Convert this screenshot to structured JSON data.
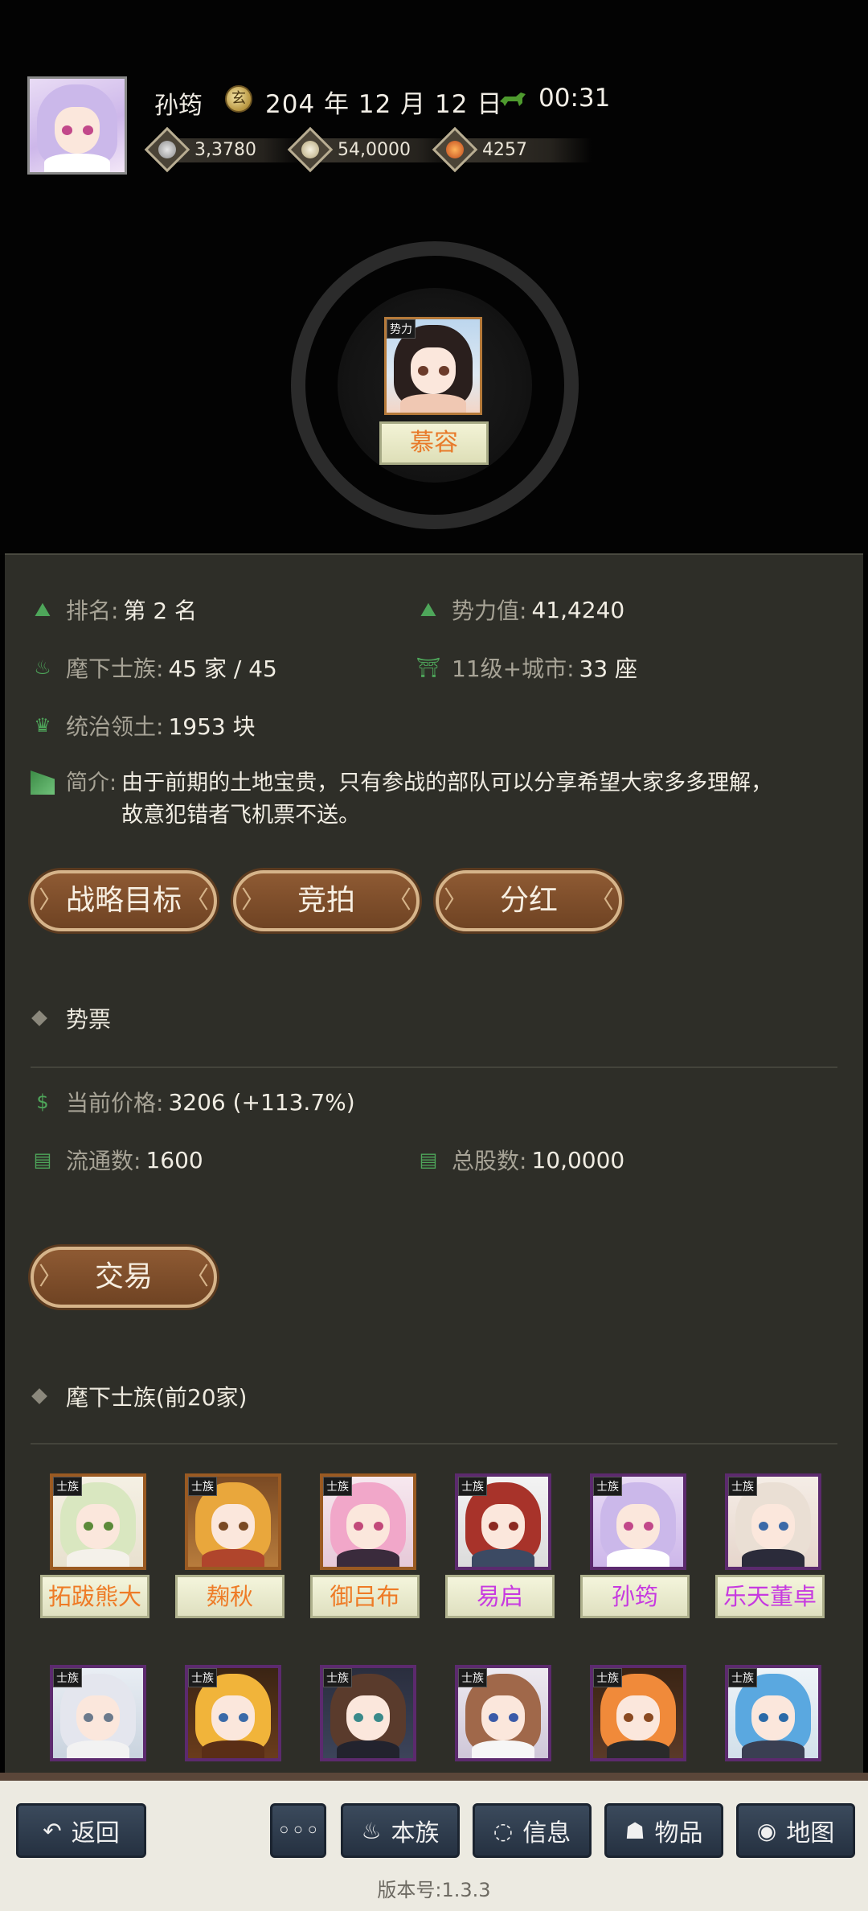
{
  "header": {
    "player_name": "孙筠",
    "date": "204 年 12 月 12 日",
    "time": "00:31",
    "resources": [
      {
        "icon": "silver-icon",
        "value": "3,3780"
      },
      {
        "icon": "rice-icon",
        "value": "54,0000"
      },
      {
        "icon": "medal-icon",
        "value": "4257"
      }
    ]
  },
  "faction": {
    "tag": "势力",
    "name": "慕容"
  },
  "stats": {
    "rank_label": "排名:",
    "rank_value": "第 2 名",
    "power_label": "势力值:",
    "power_value": "41,4240",
    "clans_label": "麾下士族:",
    "clans_value": "45 家 / 45",
    "cities_label": "11级+城市:",
    "cities_value": "33 座",
    "territory_label": "统治领土:",
    "territory_value": "1953 块",
    "intro_label": "简介:",
    "intro_value": "由于前期的土地宝贵，只有参战的部队可以分享希望大家多多理解，故意犯错者飞机票不送。"
  },
  "actions": {
    "strategy": "战略目标",
    "auction": "竞拍",
    "dividend": "分红"
  },
  "stock": {
    "title": "势票",
    "price_label": "当前价格:",
    "price_value": "3206 (+113.7%)",
    "circulation_label": "流通数:",
    "circulation_value": "1600",
    "total_label": "总股数:",
    "total_value": "10,0000",
    "trade_button": "交易"
  },
  "clans": {
    "title": "麾下士族(前20家)",
    "tag": "士族",
    "row1": [
      {
        "name": "拓跋熊大",
        "color": "orange"
      },
      {
        "name": "麹秋",
        "color": "orange"
      },
      {
        "name": "御吕布",
        "color": "orange"
      },
      {
        "name": "易启",
        "color": "purple"
      },
      {
        "name": "孙筠",
        "color": "purple"
      },
      {
        "name": "乐天董卓",
        "color": "purple"
      }
    ]
  },
  "nav": {
    "back": "返回",
    "more": "◦◦◦",
    "clan": "本族",
    "info": "信息",
    "items": "物品",
    "map": "地图"
  },
  "version": "版本号:1.3.3"
}
